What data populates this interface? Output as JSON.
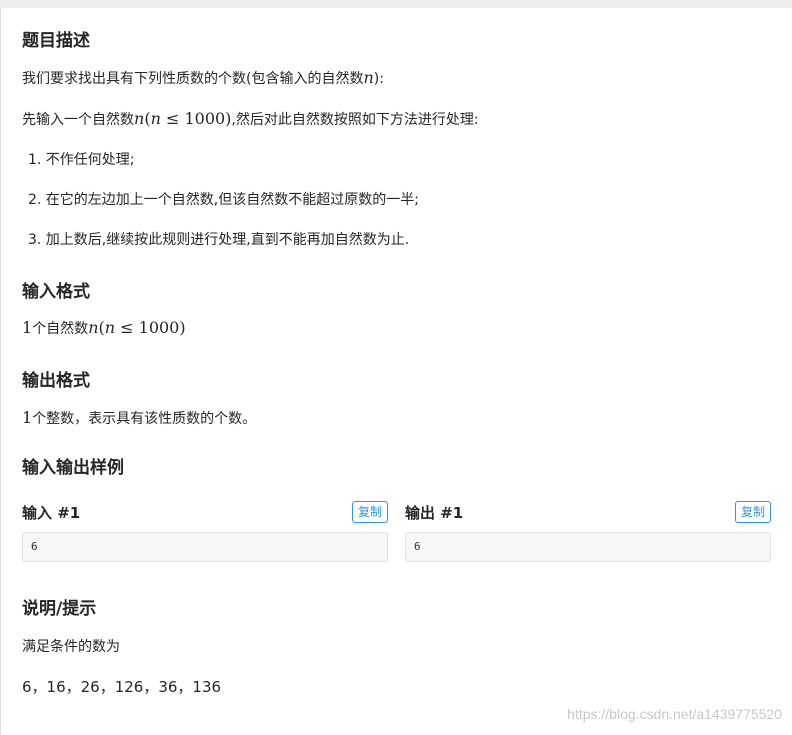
{
  "description": {
    "title": "题目描述",
    "intro_prefix": "我们要求找出具有下列性质数的个数(包含输入的自然数",
    "intro_var": "n",
    "intro_suffix": "):",
    "step_prefix": "先输入一个自然数",
    "step_var": "n",
    "step_cond_open": "(",
    "step_cond_var": "n",
    "step_cond_rest": " ≤ 1000)",
    "step_suffix": ",然后对此自然数按照如下方法进行处理:",
    "rules": [
      "1. 不作任何处理;",
      "2. 在它的左边加上一个自然数,但该自然数不能超过原数的一半;",
      "3. 加上数后,继续按此规则进行处理,直到不能再加自然数为止."
    ]
  },
  "input_format": {
    "title": "输入格式",
    "num": "1",
    "text": "个自然数",
    "var": "n",
    "cond_open": "(",
    "cond_var": "n",
    "cond_rest": " ≤ 1000)"
  },
  "output_format": {
    "title": "输出格式",
    "num": "1",
    "text": "个整数，表示具有该性质数的个数。"
  },
  "samples": {
    "title": "输入输出样例",
    "input_label": "输入 #1",
    "output_label": "输出 #1",
    "copy_label": "复制",
    "input_value": "6",
    "output_value": "6"
  },
  "hint": {
    "title": "说明/提示",
    "line1": "满足条件的数为",
    "line2": "6，16，26，126，36，136"
  },
  "watermark": "https://blog.csdn.net/a1439775520",
  "colors": {
    "accent": "#3498db",
    "text": "#262626"
  }
}
